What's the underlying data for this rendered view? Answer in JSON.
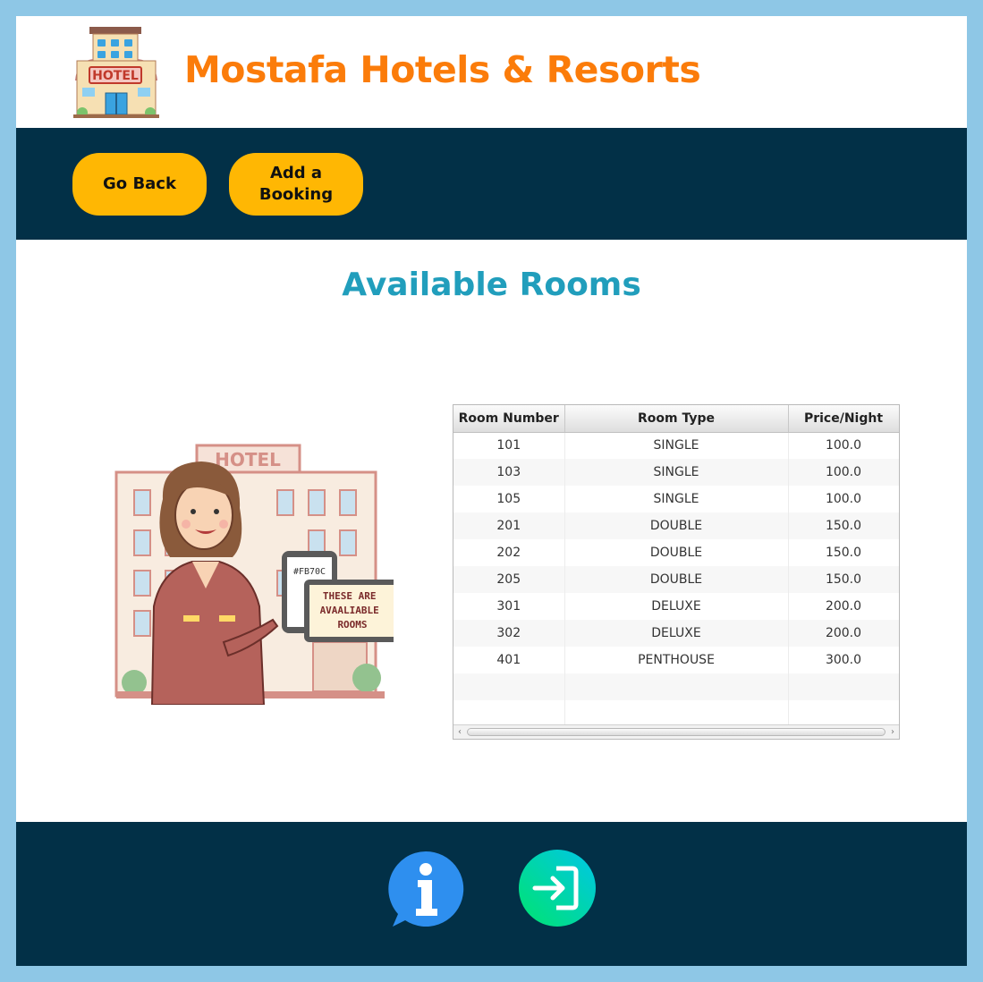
{
  "header": {
    "title": "Mostafa Hotels & Resorts",
    "logo_text": "HOTEL",
    "title_color": "#fb7c0a"
  },
  "nav": {
    "back_label": "Go Back",
    "add_booking_label": "Add a Booking",
    "bar_color": "#023047",
    "button_color": "#ffb703"
  },
  "main": {
    "title": "Available Rooms",
    "title_color": "#219ebc",
    "illustration": {
      "building_sign": "HOTEL",
      "tablet_code": "#FB70C",
      "sign_text": "THESE ARE AVAALIABLE ROOMS"
    }
  },
  "table": {
    "columns": [
      "Room Number",
      "Room Type",
      "Price/Night"
    ],
    "rows": [
      [
        "101",
        "SINGLE",
        "100.0"
      ],
      [
        "103",
        "SINGLE",
        "100.0"
      ],
      [
        "105",
        "SINGLE",
        "100.0"
      ],
      [
        "201",
        "DOUBLE",
        "150.0"
      ],
      [
        "202",
        "DOUBLE",
        "150.0"
      ],
      [
        "205",
        "DOUBLE",
        "150.0"
      ],
      [
        "301",
        "DELUXE",
        "200.0"
      ],
      [
        "302",
        "DELUXE",
        "200.0"
      ],
      [
        "401",
        "PENTHOUSE",
        "300.0"
      ]
    ]
  },
  "footer": {
    "icons": [
      "info-icon",
      "logout-icon"
    ]
  }
}
